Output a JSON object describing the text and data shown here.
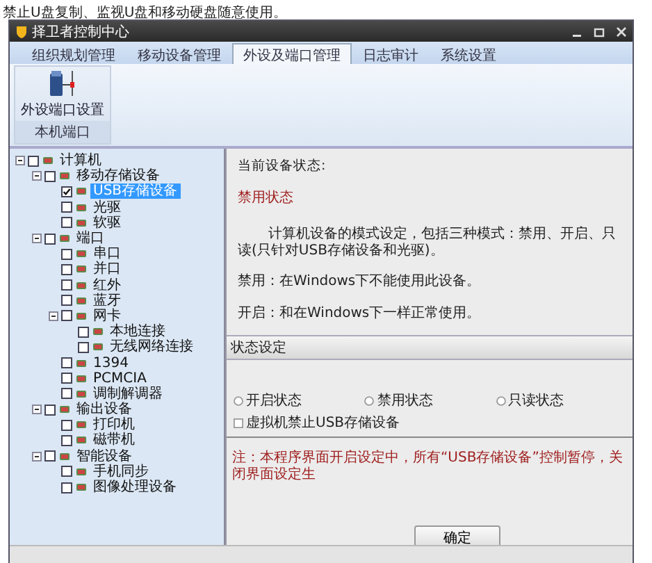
{
  "caption": "禁止U盘复制、监视U盘和移动硬盘随意使用。",
  "window": {
    "title": "择卫者控制中心"
  },
  "tabs": [
    {
      "label": "组织规划管理",
      "selected": false
    },
    {
      "label": "移动设备管理",
      "selected": false
    },
    {
      "label": "外设及端口管理",
      "selected": true
    },
    {
      "label": "日志审计",
      "selected": false
    },
    {
      "label": "系统设置",
      "selected": false
    }
  ],
  "ribbon": {
    "button": "外设端口设置",
    "group_label": "本机端口"
  },
  "tree": [
    {
      "label": "计算机",
      "checked": false,
      "selected": false,
      "expanded": true,
      "children": [
        {
          "label": "移动存储设备",
          "checked": false,
          "selected": false,
          "expanded": true,
          "children": [
            {
              "label": "USB存储设备",
              "checked": true,
              "selected": true
            },
            {
              "label": "光驱",
              "checked": false,
              "selected": false
            },
            {
              "label": "软驱",
              "checked": false,
              "selected": false
            }
          ]
        },
        {
          "label": "端口",
          "checked": false,
          "selected": false,
          "expanded": true,
          "children": [
            {
              "label": "串口",
              "checked": false,
              "selected": false
            },
            {
              "label": "并口",
              "checked": false,
              "selected": false
            },
            {
              "label": "红外",
              "checked": false,
              "selected": false
            },
            {
              "label": "蓝牙",
              "checked": false,
              "selected": false
            },
            {
              "label": "网卡",
              "checked": false,
              "selected": false,
              "expanded": true,
              "children": [
                {
                  "label": "本地连接",
                  "checked": false,
                  "selected": false
                },
                {
                  "label": "无线网络连接",
                  "checked": false,
                  "selected": false
                }
              ]
            },
            {
              "label": "1394",
              "checked": false,
              "selected": false
            },
            {
              "label": "PCMCIA",
              "checked": false,
              "selected": false
            },
            {
              "label": "调制解调器",
              "checked": false,
              "selected": false
            }
          ]
        },
        {
          "label": "输出设备",
          "checked": false,
          "selected": false,
          "expanded": true,
          "children": [
            {
              "label": "打印机",
              "checked": false,
              "selected": false
            },
            {
              "label": "磁带机",
              "checked": false,
              "selected": false
            }
          ]
        },
        {
          "label": "智能设备",
          "checked": false,
          "selected": false,
          "expanded": true,
          "children": [
            {
              "label": "手机同步",
              "checked": false,
              "selected": false
            },
            {
              "label": "图像处理设备",
              "checked": false,
              "selected": false
            }
          ]
        }
      ]
    }
  ],
  "detail": {
    "status_label": "当前设备状态:",
    "status_value": "禁用状态",
    "description": "计算机设备的模式设定，包括三种模式：禁用、开启、只读(只针对USB存储设备和光驱)。",
    "notes": [
      "禁用：在Windows下不能使用此设备。",
      "开启：和在Windows下一样正常使用。"
    ],
    "group": {
      "title": "状态设定",
      "radios": [
        {
          "label": "开启状态",
          "selected": false
        },
        {
          "label": "禁用状态",
          "selected": false
        },
        {
          "label": "只读状态",
          "selected": false
        }
      ],
      "checkbox": {
        "label": "虚拟机禁止USB存储设备",
        "checked": false
      }
    },
    "warning": "注：本程序界面开启设定中，所有“USB存储设备”控制暂停，关闭界面设定生",
    "ok_button": "确定"
  }
}
